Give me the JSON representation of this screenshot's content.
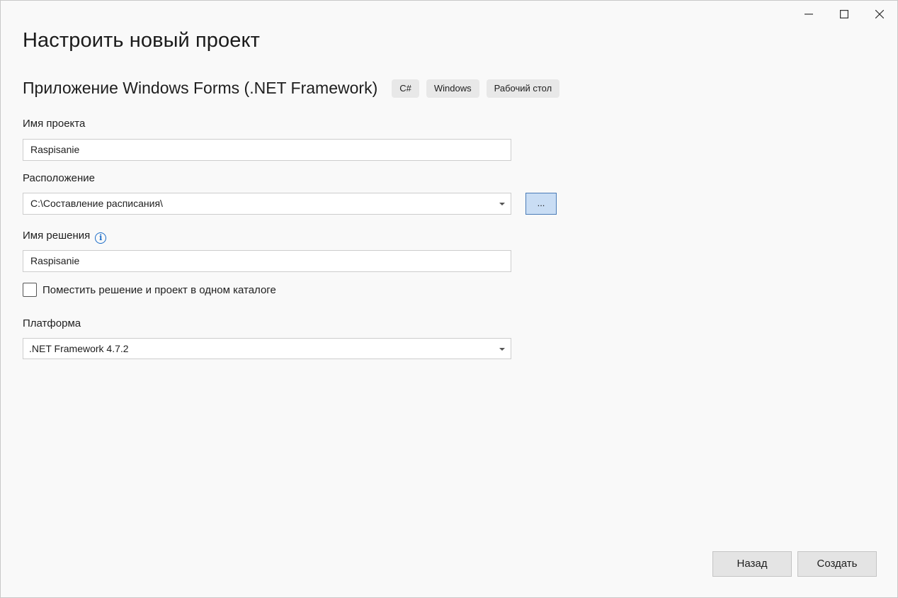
{
  "window": {
    "controls": {
      "minimize": "minimize",
      "maximize": "maximize",
      "close": "close"
    }
  },
  "page": {
    "title": "Настроить новый проект"
  },
  "template": {
    "name": "Приложение Windows Forms (.NET Framework)",
    "tags": [
      "C#",
      "Windows",
      "Рабочий стол"
    ]
  },
  "form": {
    "project_name": {
      "label": "Имя проекта",
      "value": "Raspisanie"
    },
    "location": {
      "label": "Расположение",
      "value": "C:\\Составление расписания\\",
      "browse_label": "..."
    },
    "solution_name": {
      "label": "Имя решения",
      "value": "Raspisanie",
      "info_glyph": "i"
    },
    "same_dir_checkbox": {
      "label": "Поместить решение и проект в одном каталоге",
      "checked": false
    },
    "framework": {
      "label": "Платформа",
      "value": ".NET Framework 4.7.2"
    }
  },
  "footer": {
    "back_label": "Назад",
    "create_label": "Создать"
  },
  "colors": {
    "accent": "#1a6cc8",
    "background": "#f9f9f9",
    "browse_fill": "#c9ddf4"
  }
}
